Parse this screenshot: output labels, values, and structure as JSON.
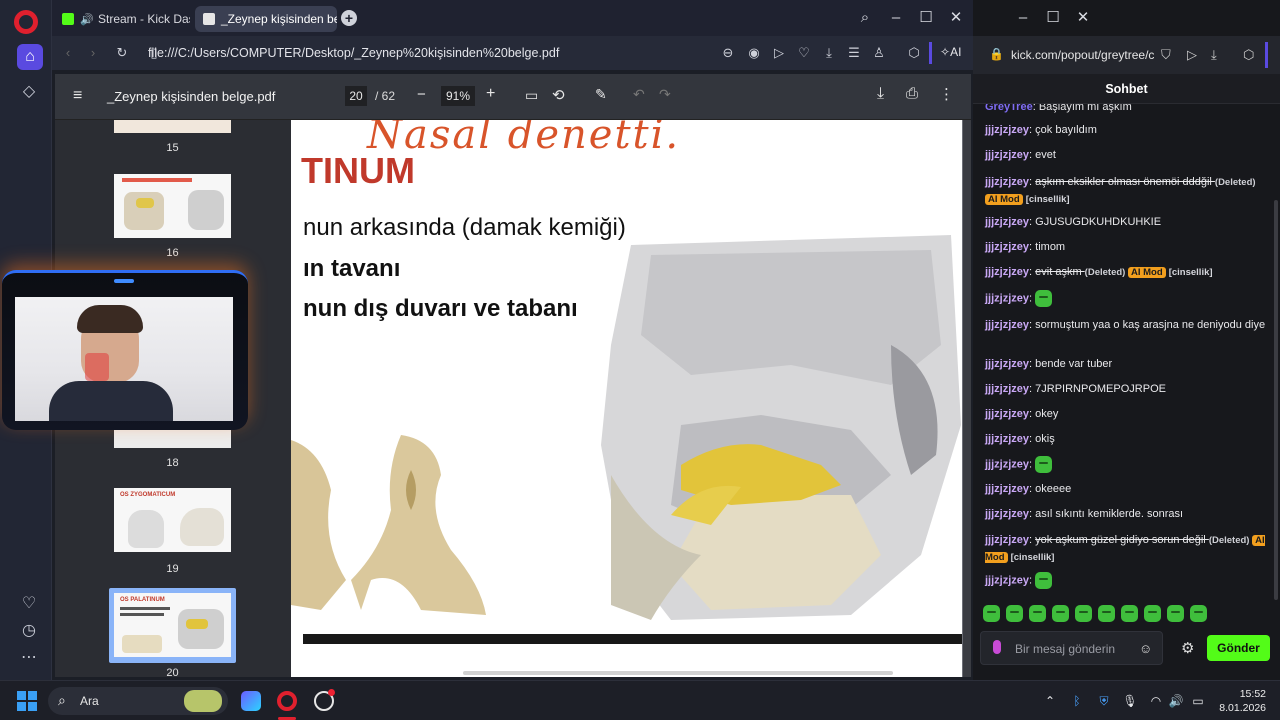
{
  "browser": {
    "tabs": [
      {
        "label": "Stream - Kick Dashboard",
        "favicon_color": "#53fc18"
      },
      {
        "label": "_Zeynep kişisinden belge.pdf",
        "favicon_color": "#e6e6e6"
      }
    ],
    "url": "file:///C:/Users/COMPUTER/Desktop/_Zeynep%20kişisinden%20belge.pdf",
    "ai_label": "AI"
  },
  "pdf": {
    "title": "_Zeynep kişisinden belge.pdf",
    "current_page": "20",
    "total_pages": "/ 62",
    "zoom": "91%",
    "thumbnails": [
      {
        "num": "15"
      },
      {
        "num": "16"
      },
      {
        "num": "18"
      },
      {
        "num": "19",
        "heading": "OS ZYGOMATICUM"
      },
      {
        "num": "20",
        "heading": "OS PALATINUM"
      }
    ],
    "page": {
      "handwriting": "Nasal denetti.",
      "heading": "TINUM",
      "lines": [
        "nun arkasında (damak kemiği)",
        "ın tavanı",
        "nun dış duvarı ve tabanı"
      ]
    }
  },
  "kick": {
    "url": "kick.com/popout/greytree/c",
    "chat_title": "Sohbet",
    "messages": [
      {
        "user": "GreyTree",
        "text": "Başlayım mı aşkım"
      },
      {
        "user": "jjjzjzjzey",
        "text": "çok bayıldım"
      },
      {
        "user": "jjjzjzjzey",
        "text": "evet"
      },
      {
        "user": "jjjzjzjzey",
        "text": "aşkım eksikler olması önemöi dddğil",
        "deleted": "(Deleted)",
        "mod": "AI Mod",
        "category": "[cinsellik]"
      },
      {
        "user": "jjjzjzjzey",
        "text": "GJUSUGDKUHDKUHKIE"
      },
      {
        "user": "jjjzjzjzey",
        "text": "timom"
      },
      {
        "user": "jjjzjzjzey",
        "text": "evit aşkm",
        "deleted": "(Deleted)",
        "mod": "AI Mod",
        "category": "[cinsellik]"
      },
      {
        "user": "jjjzjzjzey",
        "text": ""
      },
      {
        "user": "jjjzjzjzey",
        "text": "sormuştum yaa o kaş arasjna ne deniyodu diye"
      },
      {
        "user": "jjjzjzjzey",
        "text": "bende var tuber"
      },
      {
        "user": "jjjzjzjzey",
        "text": "7JRPIRNPOMEPOJRPOE"
      },
      {
        "user": "jjjzjzjzey",
        "text": "okey"
      },
      {
        "user": "jjjzjzjzey",
        "text": "okiş"
      },
      {
        "user": "jjjzjzjzey",
        "text": ""
      },
      {
        "user": "jjjzjzjzey",
        "text": "okeeee"
      },
      {
        "user": "jjjzjzjzey",
        "text": "asıl sıkıntı kemiklerde. sonrası"
      },
      {
        "user": "jjjzjzjzey",
        "text": "yok aşkum güzel gidiyo sorun değil",
        "deleted": "(Deleted)",
        "mod": "AI Mod",
        "category": "[cinsellik]"
      },
      {
        "user": "jjjzjzjzey",
        "text": ""
      }
    ],
    "input_placeholder": "Bir mesaj gönderin",
    "send_label": "Gönder",
    "emote_count": 10
  },
  "taskbar": {
    "search_label": "Ara",
    "time": "15:52",
    "date": "8.01.2026"
  },
  "colors": {
    "kick_green": "#53fc18",
    "opera_red": "#e0202e",
    "accent_purple": "#5a4ae0",
    "mod_badge": "#f29f1e"
  }
}
